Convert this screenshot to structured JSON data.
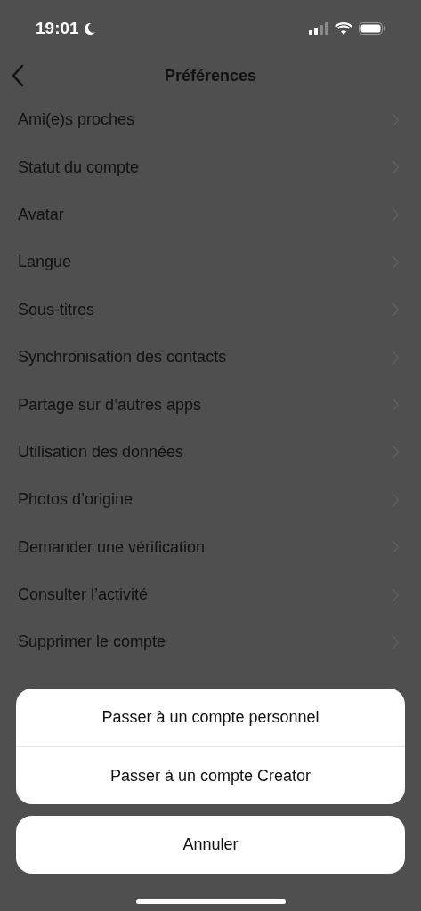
{
  "status_bar": {
    "time": "19:01"
  },
  "nav": {
    "title": "Préférences"
  },
  "items": [
    {
      "label": "Ami(e)s proches"
    },
    {
      "label": "Statut du compte"
    },
    {
      "label": "Avatar"
    },
    {
      "label": "Langue"
    },
    {
      "label": "Sous-titres"
    },
    {
      "label": "Synchronisation des contacts"
    },
    {
      "label": "Partage sur d’autres apps"
    },
    {
      "label": "Utilisation des données"
    },
    {
      "label": "Photos d’origine"
    },
    {
      "label": "Demander une vérification"
    },
    {
      "label": "Consulter l’activité"
    },
    {
      "label": "Supprimer le compte"
    }
  ],
  "action_sheet": {
    "actions": [
      {
        "label": "Passer à un compte personnel"
      },
      {
        "label": "Passer à un compte Creator"
      }
    ],
    "cancel": "Annuler"
  }
}
